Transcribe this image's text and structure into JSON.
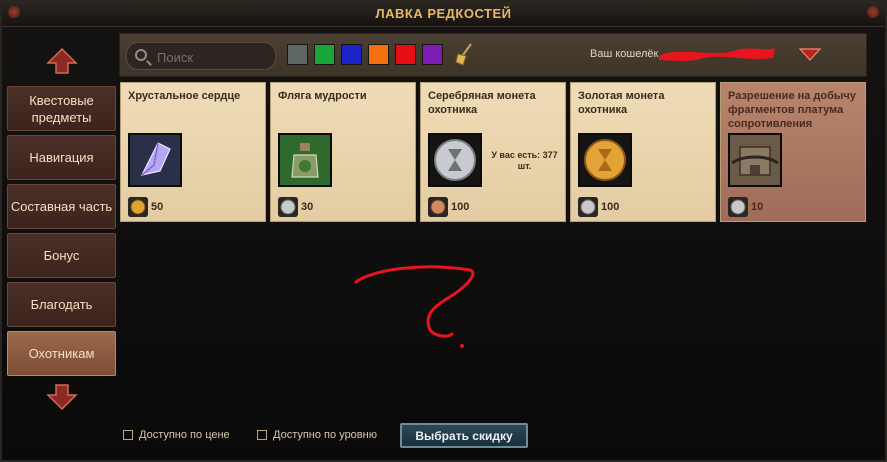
{
  "window": {
    "title": "ЛАВКА РЕДКОСТЕЙ"
  },
  "sidebar": {
    "items": [
      {
        "label": "Квестовые предметы",
        "active": false
      },
      {
        "label": "Навигация",
        "active": false
      },
      {
        "label": "Составная часть",
        "active": false
      },
      {
        "label": "Бонус",
        "active": false
      },
      {
        "label": "Благодать",
        "active": false
      },
      {
        "label": "Охотникам",
        "active": true
      }
    ],
    "scroll_up_icon": "arrow-up-icon",
    "scroll_down_icon": "arrow-down-icon"
  },
  "filter": {
    "search_placeholder": "Поиск",
    "color_swatches": [
      "#5f6766",
      "#1aa53b",
      "#1923c8",
      "#f46f0e",
      "#e40e14",
      "#7b1cb3"
    ],
    "wallet_label": "Ваш кошелёк"
  },
  "items": [
    {
      "name": "Хрустальное сердце",
      "icon": "crystal-icon",
      "currency": "gold",
      "price": "50",
      "owned": ""
    },
    {
      "name": "Фляга мудрости",
      "icon": "flask-icon",
      "currency": "silver",
      "price": "30",
      "owned": ""
    },
    {
      "name": "Серебряная монета охотника",
      "icon": "silver-hourglass-coin-icon",
      "currency": "bronze",
      "price": "100",
      "owned": "У вас есть: 377 шт."
    },
    {
      "name": "Золотая монета охотника",
      "icon": "gold-hourglass-coin-icon",
      "currency": "silver",
      "price": "100",
      "owned": ""
    },
    {
      "name": "Разрешение на добычу фрагментов платума сопротивления",
      "icon": "chained-chest-icon",
      "currency": "silver",
      "price": "10",
      "owned": "",
      "locked": true
    }
  ],
  "footer": {
    "price_filter_label": "Доступно по цене",
    "level_filter_label": "Доступно по уровню",
    "discount_button_label": "Выбрать скидку"
  },
  "colors": {
    "accent_title": "#e8b868",
    "nav_active": "#9c6a4c",
    "card_bg": "#efdcb7",
    "card_locked_bg": "#b7856d",
    "annotation_red": "#e8141e"
  }
}
